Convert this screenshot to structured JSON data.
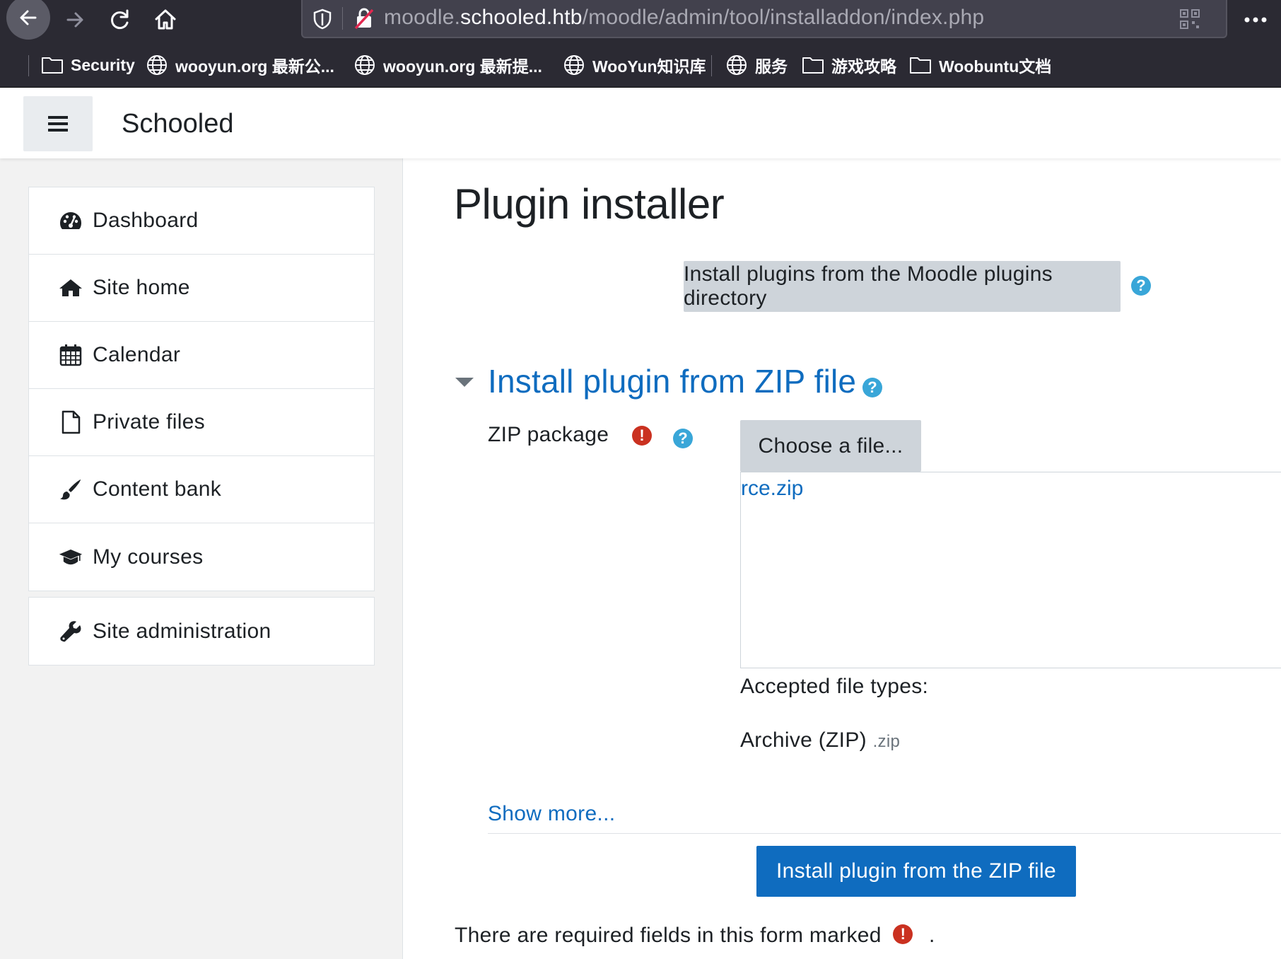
{
  "browser": {
    "url_prefix": "moodle.",
    "url_host": "schooled.htb",
    "url_path": "/moodle/admin/tool/installaddon/index.php",
    "bookmarks": [
      {
        "label": "Security",
        "icon": "folder-icon"
      },
      {
        "label": "wooyun.org 最新公...",
        "icon": "globe-icon"
      },
      {
        "label": "wooyun.org 最新提...",
        "icon": "globe-icon"
      },
      {
        "label": "WooYun知识库",
        "icon": "globe-icon"
      },
      {
        "label": "服务",
        "icon": "globe-icon"
      },
      {
        "label": "游戏攻略",
        "icon": "folder-icon"
      },
      {
        "label": "Woobuntu文档",
        "icon": "folder-icon"
      }
    ]
  },
  "header": {
    "site_name": "Schooled"
  },
  "sidebar": {
    "items": [
      {
        "label": "Dashboard",
        "icon": "dashboard-icon"
      },
      {
        "label": "Site home",
        "icon": "home-icon"
      },
      {
        "label": "Calendar",
        "icon": "calendar-icon"
      },
      {
        "label": "Private files",
        "icon": "file-icon"
      },
      {
        "label": "Content bank",
        "icon": "brush-icon"
      },
      {
        "label": "My courses",
        "icon": "graduation-cap-icon"
      }
    ],
    "admin_item": {
      "label": "Site administration",
      "icon": "wrench-icon"
    }
  },
  "main": {
    "title": "Plugin installer",
    "directory_button": "Install plugins from the Moodle plugins directory",
    "section_legend": "Install plugin from ZIP file",
    "zip_label": "ZIP package",
    "choose_file_button": "Choose a file...",
    "selected_file": "rce.zip",
    "accepted_types_label": "Accepted file types:",
    "accepted_type_name": "Archive (ZIP)",
    "accepted_type_ext": ".zip",
    "show_more": "Show more...",
    "install_button": "Install plugin from the ZIP file",
    "required_note": "There are required fields in this form marked",
    "required_note_end": "."
  },
  "colors": {
    "brand_primary": "#0f6cbf",
    "help": "#39a6d8",
    "required": "#ca3120",
    "browser_chrome": "#2b2a33"
  }
}
